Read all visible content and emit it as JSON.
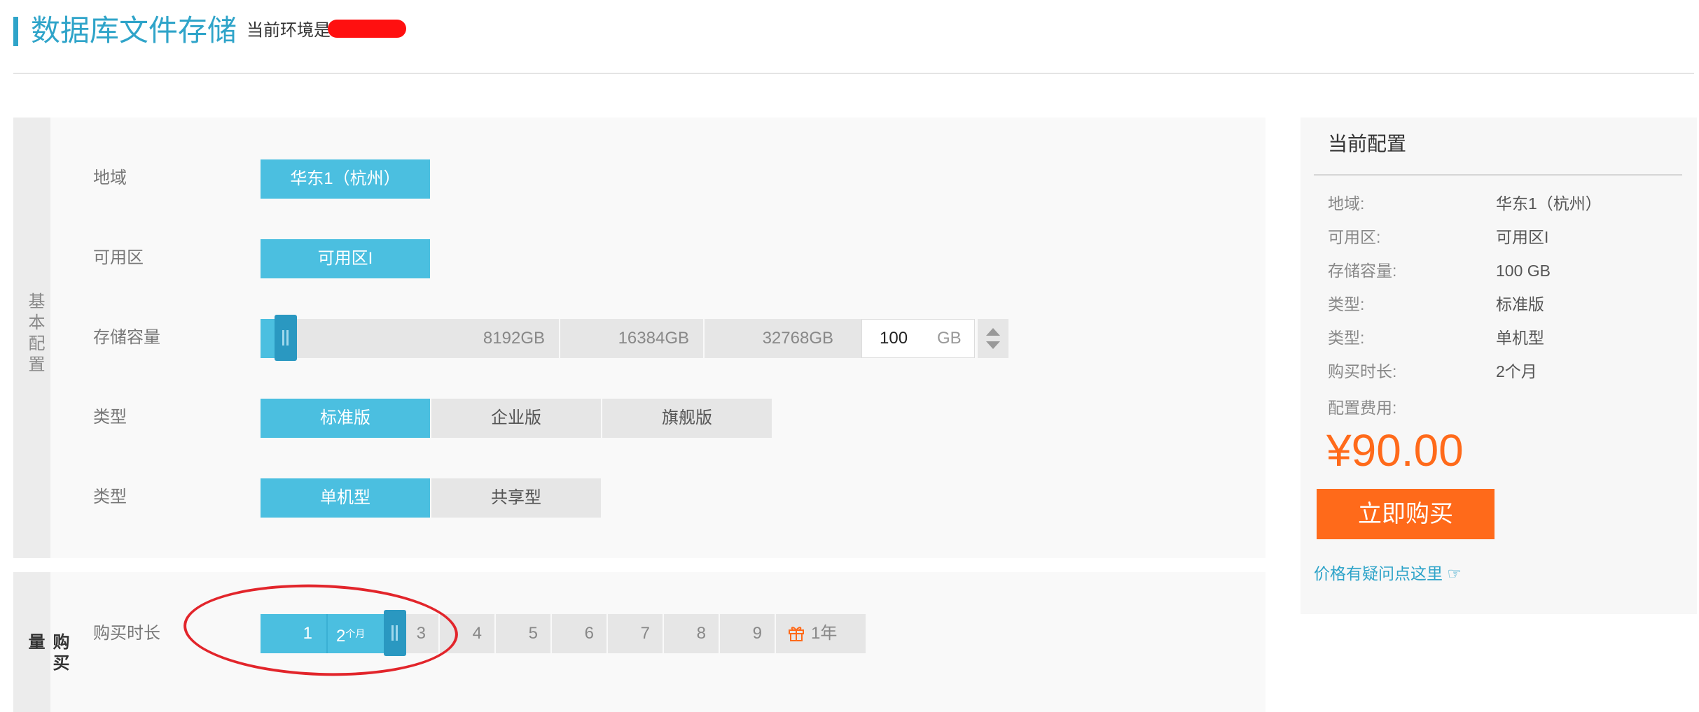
{
  "header": {
    "title": "数据库文件存储",
    "env_label": "当前环境是"
  },
  "basic": {
    "tab_label": "基本配置",
    "region": {
      "label": "地域",
      "options": [
        "华东1（杭州）"
      ],
      "selected": 0
    },
    "zone": {
      "label": "可用区",
      "options": [
        "可用区I"
      ],
      "selected": 0
    },
    "storage": {
      "label": "存储容量",
      "ticks": [
        "8192GB",
        "16384GB",
        "32768GB"
      ],
      "value": "100",
      "unit": "GB",
      "slider_level_gb": 100
    },
    "edition": {
      "label": "类型",
      "options": [
        "标准版",
        "企业版",
        "旗舰版"
      ],
      "selected": 0
    },
    "mode": {
      "label": "类型",
      "options": [
        "单机型",
        "共享型"
      ],
      "selected": 0
    }
  },
  "duration": {
    "tab_label": "购买量",
    "label": "购买时长",
    "options": [
      "1",
      "2",
      "3",
      "4",
      "5",
      "6",
      "7",
      "8",
      "9",
      "1年"
    ],
    "selected_suffix": "个月",
    "selected": 1
  },
  "summary": {
    "title": "当前配置",
    "rows": [
      {
        "key": "地域:",
        "value": "华东1（杭州）"
      },
      {
        "key": "可用区:",
        "value": "可用区I"
      },
      {
        "key": "存储容量:",
        "value": "100 GB"
      },
      {
        "key": "类型:",
        "value": "标准版"
      },
      {
        "key": "类型:",
        "value": "单机型"
      },
      {
        "key": "购买时长:",
        "value": "2个月"
      }
    ],
    "fee_label": "配置费用:",
    "price": "¥90.00",
    "buy_label": "立即购买",
    "help_link": "价格有疑问点这里 ☞"
  },
  "colors": {
    "accent": "#2fa4c9",
    "selected": "#4bbfe0",
    "price": "#ff6a1a",
    "annotation": "#e2252b"
  }
}
